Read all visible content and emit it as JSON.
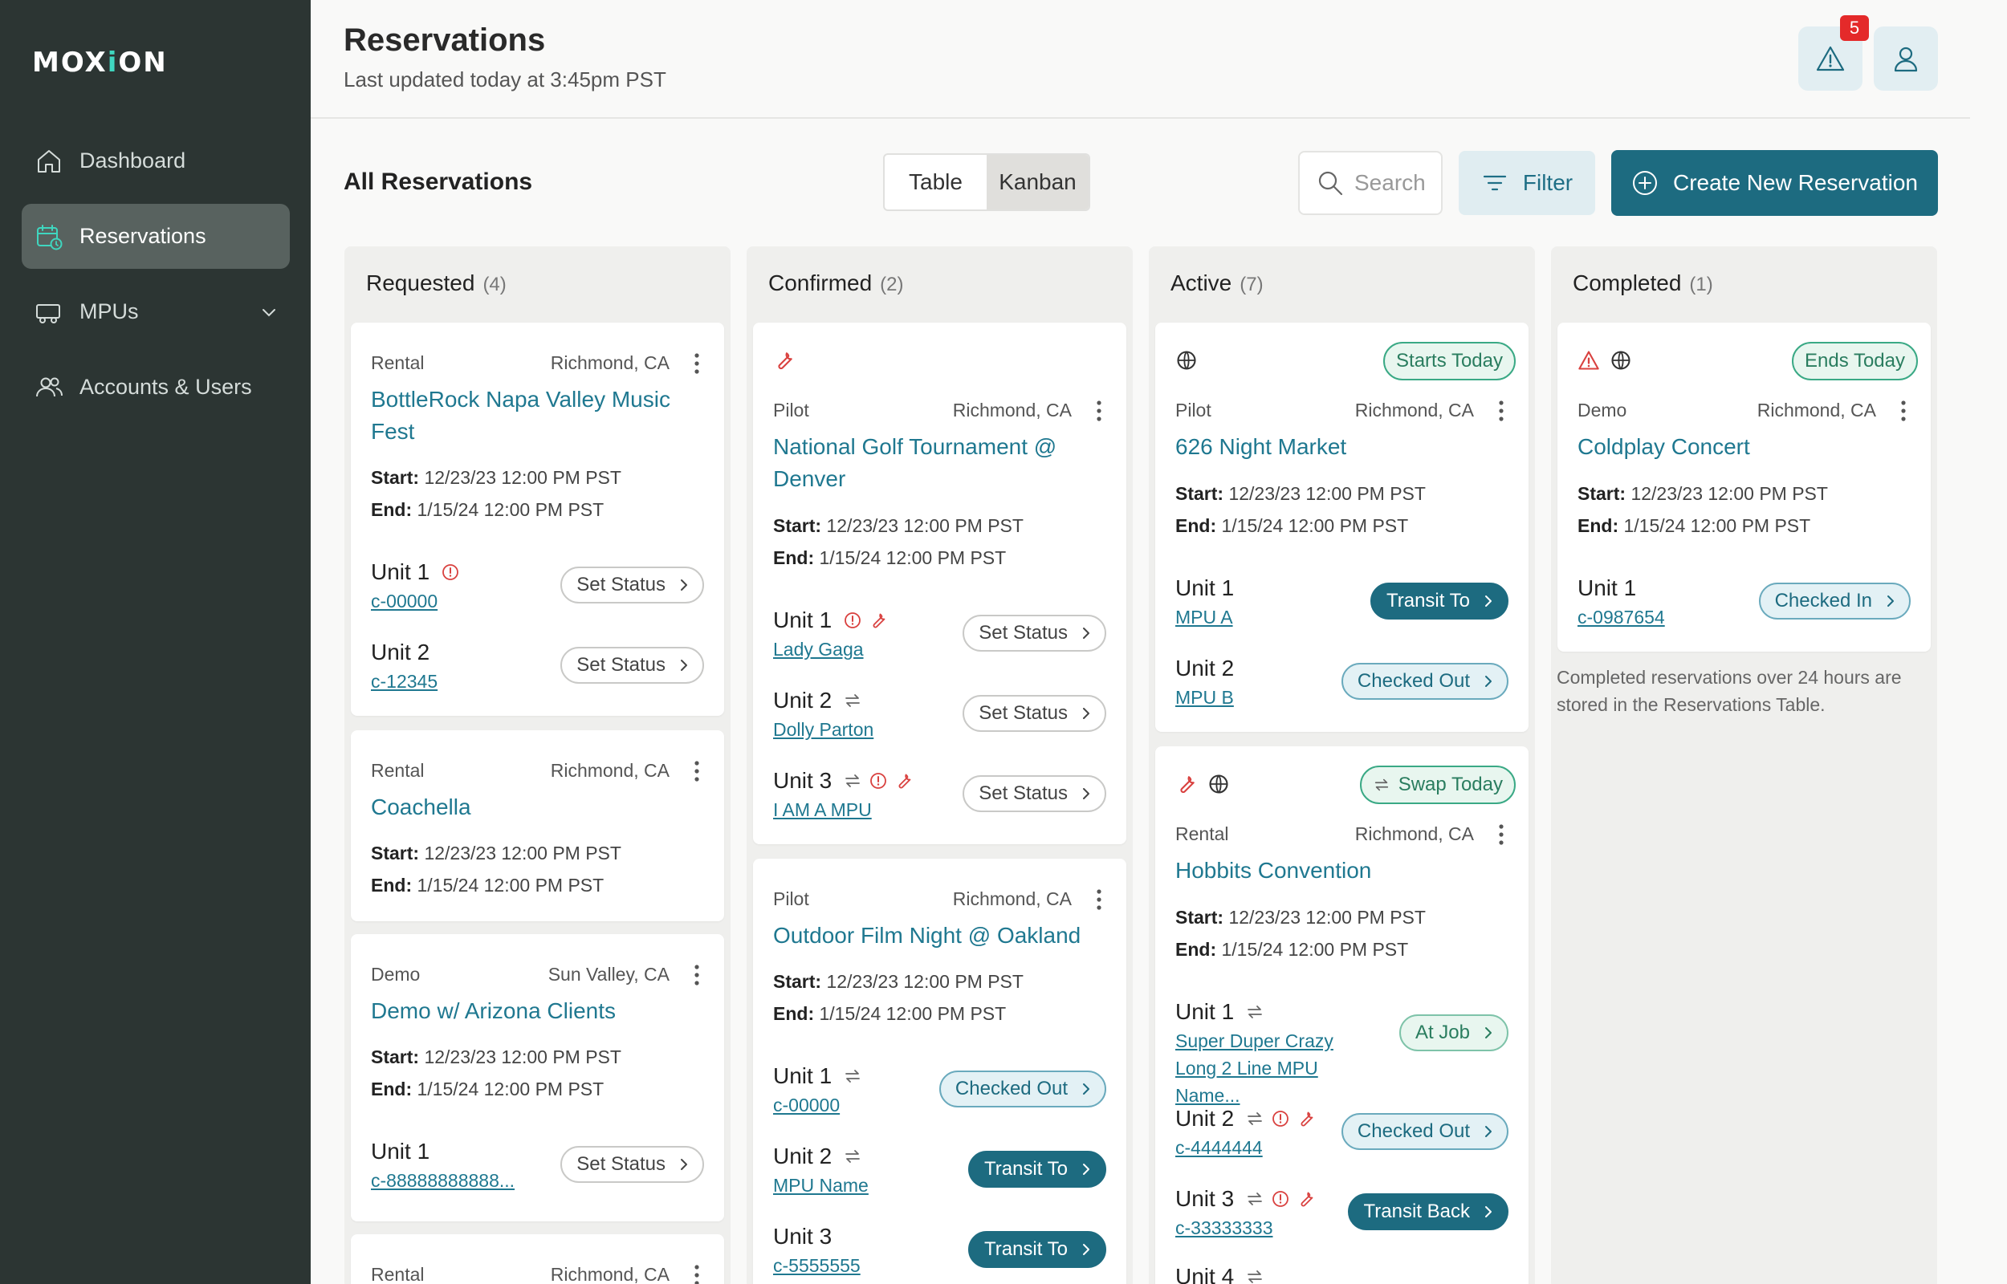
{
  "app": {
    "logo_left": "MOX",
    "logo_i": "i",
    "logo_right": "ON"
  },
  "nav": [
    {
      "label": "Dashboard",
      "icon": "home-icon"
    },
    {
      "label": "Reservations",
      "icon": "calendar-clock-icon"
    },
    {
      "label": "MPUs",
      "icon": "trailer-icon"
    },
    {
      "label": "Accounts & Users",
      "icon": "users-icon"
    }
  ],
  "header": {
    "title": "Reservations",
    "subtitle": "Last updated today at 3:45pm PST",
    "alert_count": "5"
  },
  "toolbar": {
    "section_title": "All Reservations",
    "view_table": "Table",
    "view_kanban": "Kanban",
    "search_placeholder": "Search",
    "filter": "Filter",
    "create": "Create New Reservation"
  },
  "colors": {
    "accent": "#1d6b80",
    "sidebar": "#2c3533",
    "alert": "#e42a2a",
    "link": "#1f7890"
  },
  "columns": [
    {
      "title": "Requested",
      "count": "(4)"
    },
    {
      "title": "Confirmed",
      "count": "(2)"
    },
    {
      "title": "Active",
      "count": "(7)"
    },
    {
      "title": "Completed",
      "count": "(1)"
    }
  ],
  "labels": {
    "start": "Start:",
    "end": "End:",
    "start_val": "12/23/23 12:00 PM PST",
    "end_val": "1/15/24 12:00 PM PST"
  },
  "completed_note": "Completed reservations over 24 hours are stored in the Reservations Table.",
  "cards": {
    "r1": {
      "type": "Rental",
      "loc": "Richmond, CA",
      "title": "BottleRock Napa Valley Music Fest",
      "units": [
        {
          "label": "Unit 1",
          "link": "c-00000",
          "action": "Set Status"
        },
        {
          "label": "Unit 2",
          "link": "c-12345",
          "action": "Set Status"
        }
      ]
    },
    "r2": {
      "type": "Rental",
      "loc": "Richmond, CA",
      "title": "Coachella"
    },
    "r3": {
      "type": "Demo",
      "loc": "Sun Valley, CA",
      "title": "Demo w/ Arizona Clients",
      "units": [
        {
          "label": "Unit 1",
          "link": "c-88888888888...",
          "action": "Set Status"
        }
      ]
    },
    "r4": {
      "type": "Rental",
      "loc": "Richmond, CA"
    },
    "c1": {
      "type": "Pilot",
      "loc": "Richmond, CA",
      "title": "National Golf Tournament @ Denver",
      "units": [
        {
          "label": "Unit 1",
          "link": "Lady Gaga",
          "action": "Set Status"
        },
        {
          "label": "Unit 2",
          "link": "Dolly Parton",
          "action": "Set Status"
        },
        {
          "label": "Unit 3",
          "link": "I AM A MPU",
          "action": "Set Status"
        }
      ]
    },
    "c2": {
      "type": "Pilot",
      "loc": "Richmond, CA",
      "title": "Outdoor Film Night @ Oakland",
      "units": [
        {
          "label": "Unit 1",
          "link": "c-00000",
          "action": "Checked Out"
        },
        {
          "label": "Unit 2",
          "link": "MPU Name",
          "action": "Transit To"
        },
        {
          "label": "Unit 3",
          "link": "c-5555555",
          "action": "Transit To"
        }
      ]
    },
    "a1": {
      "tag": "Starts Today",
      "type": "Pilot",
      "loc": "Richmond, CA",
      "title": "626 Night Market",
      "units": [
        {
          "label": "Unit 1",
          "link": "MPU A",
          "action": "Transit To"
        },
        {
          "label": "Unit 2",
          "link": "MPU B",
          "action": "Checked Out"
        }
      ]
    },
    "a2": {
      "tag": "Swap Today",
      "type": "Rental",
      "loc": "Richmond, CA",
      "title": "Hobbits Convention",
      "units": [
        {
          "label": "Unit 1",
          "link": "Super Duper Crazy Long 2 Line MPU Name...",
          "action": "At Job"
        },
        {
          "label": "Unit 2",
          "link": "c-4444444",
          "action": "Checked Out"
        },
        {
          "label": "Unit 3",
          "link": "c-33333333",
          "action": "Transit Back"
        },
        {
          "label": "Unit 4"
        }
      ]
    },
    "d1": {
      "tag": "Ends Today",
      "type": "Demo",
      "loc": "Richmond, CA",
      "title": "Coldplay Concert",
      "units": [
        {
          "label": "Unit 1",
          "link": "c-0987654",
          "action": "Checked In"
        }
      ]
    }
  }
}
